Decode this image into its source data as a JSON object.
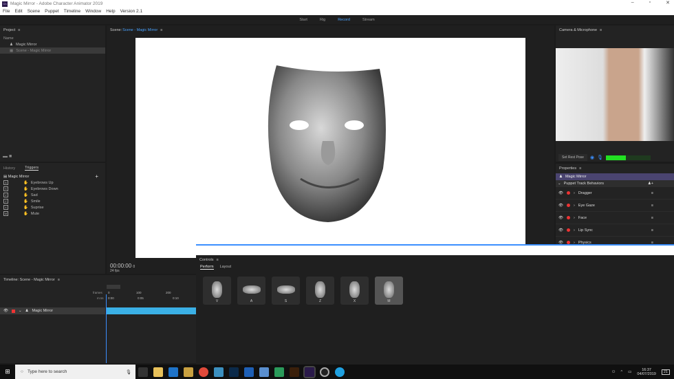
{
  "window": {
    "title": "Magic Mirror - Adobe Character Animator 2019",
    "logo": "Ch"
  },
  "menu": [
    "File",
    "Edit",
    "Scene",
    "Puppet",
    "Timeline",
    "Window",
    "Help",
    "Version 2.1"
  ],
  "workspaces": [
    "Start",
    "Rig",
    "Record",
    "Stream"
  ],
  "project": {
    "title": "Project",
    "column": "Name",
    "items": [
      "Magic Mirror",
      "Scene - Magic Mirror"
    ]
  },
  "scene": {
    "label": "Scene:",
    "name": "Scene - Magic Mirror",
    "timecode": "00:00:00",
    "frame": "0",
    "fps": "24 fps"
  },
  "camera": {
    "title": "Camera & Microphone",
    "rest_pose": "Set Rest Pose",
    "mic_level": 0.45
  },
  "properties": {
    "title": "Properties",
    "puppet": "Magic Mirror",
    "group": "Puppet Track Behaviors",
    "behaviors": [
      "Dragger",
      "Eye Gaze",
      "Face",
      "Lip Sync",
      "Physics"
    ]
  },
  "triggers": {
    "tabs": [
      "History",
      "Triggers"
    ],
    "puppet": "Magic Mirror",
    "items": [
      {
        "key": "A",
        "label": "Eyebrows Up"
      },
      {
        "key": "S",
        "label": "Eyebrows Down"
      },
      {
        "key": "V",
        "label": "Sad"
      },
      {
        "key": "Z",
        "label": "Smile"
      },
      {
        "key": "X",
        "label": "Suprise"
      },
      {
        "key": "M",
        "label": "Mute"
      }
    ]
  },
  "timeline": {
    "title": "Timeline: Scene - Magic Mirror",
    "frames_label": "frames",
    "time_label": "m:ss",
    "frame_ticks": [
      "0",
      "100",
      "200"
    ],
    "time_ticks": [
      "0:00",
      "0:05",
      "0:10"
    ],
    "track": "Magic Mirror"
  },
  "controls": {
    "title": "Controls",
    "tabs": [
      "Perform",
      "Layout"
    ],
    "buttons": [
      "V",
      "A",
      "S",
      "Z",
      "X",
      "M"
    ]
  },
  "taskbar": {
    "search": "Type here to search",
    "time": "16:37",
    "date": "04/07/2019",
    "notif": "21"
  }
}
